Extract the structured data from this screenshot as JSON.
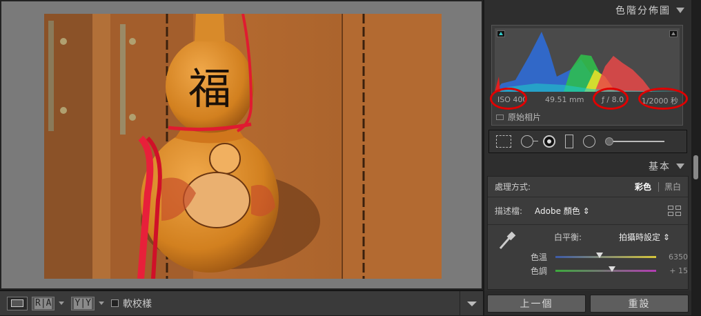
{
  "colors": {
    "accent": "#e00000",
    "panel_bg": "#2e2e2e",
    "viewer_bg": "#7a7a7a"
  },
  "viewer": {
    "bottom_bar": {
      "view_mode_icon": "loupe-view-icon",
      "compare_ra": "R|A",
      "compare_yy": "Y|Y",
      "soft_proof_label": "軟校樣"
    }
  },
  "histogram": {
    "title": "色階分佈圖",
    "iso": "ISO 400",
    "focal_length": "49.51 mm",
    "aperture": "ƒ / 8.0",
    "shutter": "1/2000 秒",
    "original_photo_label": "原始相片"
  },
  "tools": [
    "crop-icon",
    "spot-removal-icon",
    "red-eye-icon",
    "graduated-filter-icon",
    "radial-filter-icon",
    "adjustment-brush-icon"
  ],
  "basic": {
    "title": "基本",
    "treatment_label": "處理方式:",
    "treatment_color": "彩色",
    "treatment_bw": "黑白",
    "profile_label": "描述檔:",
    "profile_value": "Adobe 顏色 ⇕",
    "wb_label": "白平衡:",
    "wb_value": "拍攝時設定 ⇕",
    "temp_label": "色溫",
    "temp_value": "6350",
    "temp_position": 0.44,
    "tint_label": "色調",
    "tint_value": "+ 15",
    "tint_position": 0.56
  },
  "actions": {
    "previous": "上一個",
    "reset": "重設"
  },
  "photo": {
    "characters": "福"
  }
}
